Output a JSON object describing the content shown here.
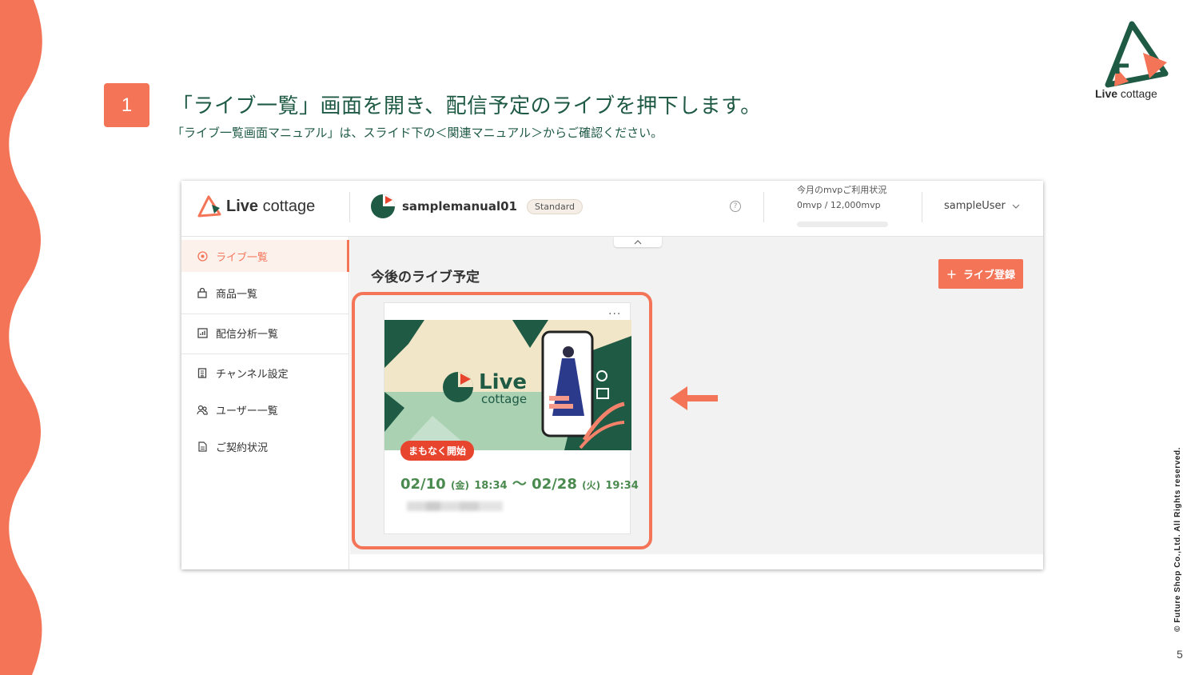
{
  "slide": {
    "step_number": "1",
    "title": "「ライブ一覧」画面を開き、配信予定のライブを押下します。",
    "subtitle": "「ライブ一覧画面マニュアル」は、スライド下の＜関連マニュアル＞からご確認ください。",
    "brand_bold": "Live",
    "brand_rest": " cottage",
    "copyright": "© Future Shop Co.,Ltd. All Rights reserved.",
    "page_number": "5",
    "accent_color": "#f47458",
    "title_color": "#1f5a45"
  },
  "app": {
    "logo_bold": "Live",
    "logo_rest": " cottage",
    "channel_name": "samplemanual01",
    "plan_badge": "Standard",
    "usage_title": "今月のmvpご利用状況",
    "usage_value": "0mvp / 12,000mvp",
    "usage_fraction": 0,
    "user_name": "sampleUser",
    "sidebar": [
      {
        "label": "ライブ一覧",
        "icon": "radio-icon",
        "active": true
      },
      {
        "label": "商品一覧",
        "icon": "bag-icon",
        "active": false
      },
      {
        "label": "配信分析一覧",
        "icon": "chart-icon",
        "active": false
      },
      {
        "label": "チャンネル設定",
        "icon": "building-icon",
        "active": false
      },
      {
        "label": "ユーザー一覧",
        "icon": "users-icon",
        "active": false
      },
      {
        "label": "ご契約状況",
        "icon": "document-icon",
        "active": false
      }
    ],
    "section_title": "今後のライブ予定",
    "add_button": "ライブ登録",
    "add_button_icon": "＋",
    "card": {
      "more": "···",
      "thumb_logo_bold": "Live",
      "thumb_logo_rest": "cottage",
      "status_badge": "まもなく開始",
      "start_date": "02/10",
      "start_weekday": "(金)",
      "start_time": "18:34",
      "separator": "〜",
      "end_date": "02/28",
      "end_weekday": "(火)",
      "end_time": "19:34"
    }
  }
}
